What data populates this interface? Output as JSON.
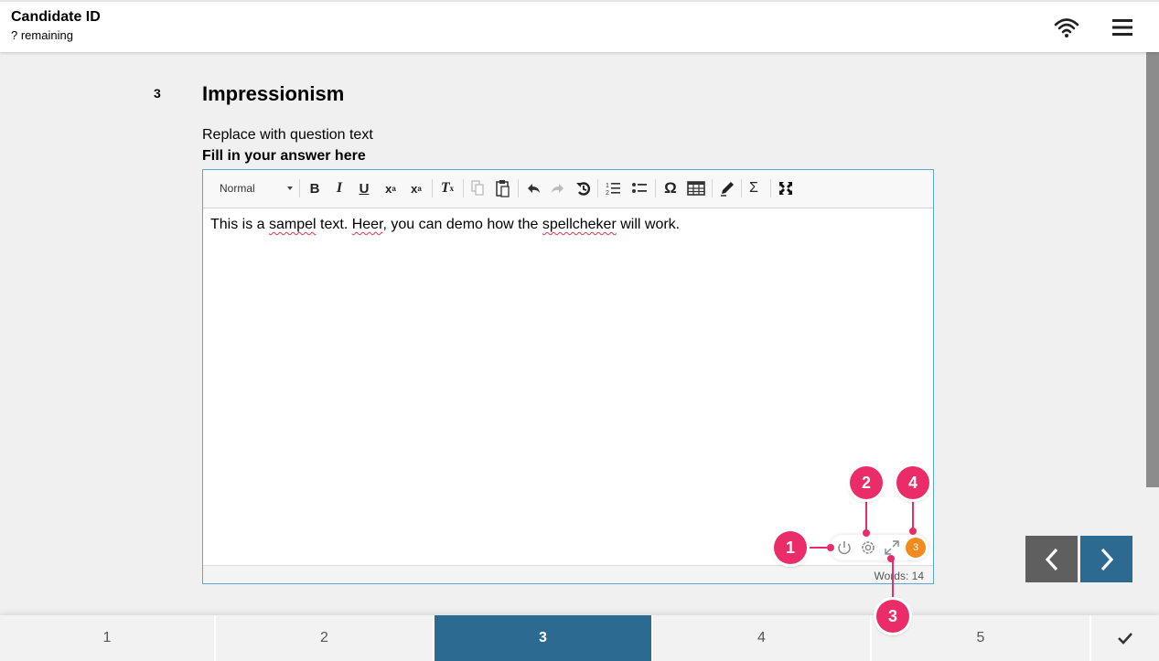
{
  "header": {
    "candidate_label": "Candidate ID",
    "remaining_label": "? remaining",
    "connection_icon": "wifi-icon",
    "menu_icon": "hamburger-menu-icon"
  },
  "question": {
    "number": "3",
    "title": "Impressionism",
    "text": "Replace with question text",
    "prompt": "Fill in your answer here"
  },
  "editor": {
    "format_select": "Normal",
    "toolbar_icons": [
      "bold-icon",
      "italic-icon",
      "underline-icon",
      "subscript-icon",
      "superscript-icon",
      "remove-format-icon",
      "copy-icon",
      "paste-icon",
      "undo-icon",
      "redo-icon",
      "revert-icon",
      "numbered-list-icon",
      "bulleted-list-icon",
      "special-character-icon",
      "table-icon",
      "pencil-icon",
      "sigma-icon",
      "maximize-icon"
    ],
    "content": {
      "p1": "This is a ",
      "w1": "sampel",
      "p2": " text. ",
      "w2": "Heer",
      "p3": ", you can demo how the ",
      "w3": "spellcheker",
      "p4": " will work."
    },
    "word_count": "Words: 14",
    "spellcheck": {
      "error_count": "3",
      "icons": [
        "power-icon",
        "settings-icon",
        "expand-icon"
      ]
    }
  },
  "callouts": [
    "1",
    "2",
    "3",
    "4"
  ],
  "colors": {
    "accent": "#2c6a91",
    "callout": "#ea2d68",
    "badge": "#f28b1c",
    "prev_button": "#5f5f5f",
    "misspelling_underline": "#d9364f"
  },
  "navigation": {
    "question_tabs": [
      "1",
      "2",
      "3",
      "4",
      "5"
    ],
    "active_tab": "3",
    "prev_icon": "chevron-left-icon",
    "next_icon": "chevron-right-icon",
    "finish_icon": "checkmark-icon"
  }
}
